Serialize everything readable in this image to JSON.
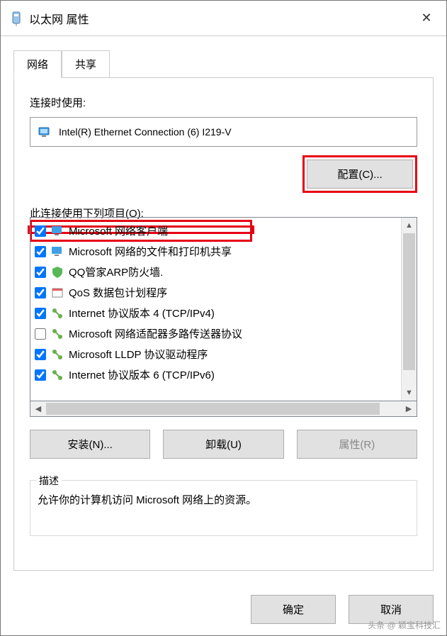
{
  "title": "以太网 属性",
  "tabs": {
    "network": "网络",
    "sharing": "共享"
  },
  "labels": {
    "connect_using": "连接时使用:",
    "adapter_name": "Intel(R) Ethernet Connection (6) I219-V",
    "configure": "配置(C)...",
    "uses_items": "此连接使用下列项目(O):",
    "install": "安装(N)...",
    "uninstall": "卸载(U)",
    "properties": "属性(R)",
    "desc_heading": "描述",
    "desc_text": "允许你的计算机访问 Microsoft 网络上的资源。",
    "ok": "确定",
    "cancel": "取消"
  },
  "items": [
    {
      "checked": true,
      "icon": "monitor",
      "label": "Microsoft 网络客户端"
    },
    {
      "checked": true,
      "icon": "monitor",
      "label": "Microsoft 网络的文件和打印机共享"
    },
    {
      "checked": true,
      "icon": "shield",
      "label": "QQ管家ARP防火墙."
    },
    {
      "checked": true,
      "icon": "schedule",
      "label": "QoS 数据包计划程序"
    },
    {
      "checked": true,
      "icon": "protocol",
      "label": "Internet 协议版本 4 (TCP/IPv4)"
    },
    {
      "checked": false,
      "icon": "protocol",
      "label": "Microsoft 网络适配器多路传送器协议"
    },
    {
      "checked": true,
      "icon": "protocol",
      "label": "Microsoft LLDP 协议驱动程序"
    },
    {
      "checked": true,
      "icon": "protocol",
      "label": "Internet 协议版本 6 (TCP/IPv6)"
    }
  ],
  "watermark": "头条 @ 颖宝科技汇"
}
